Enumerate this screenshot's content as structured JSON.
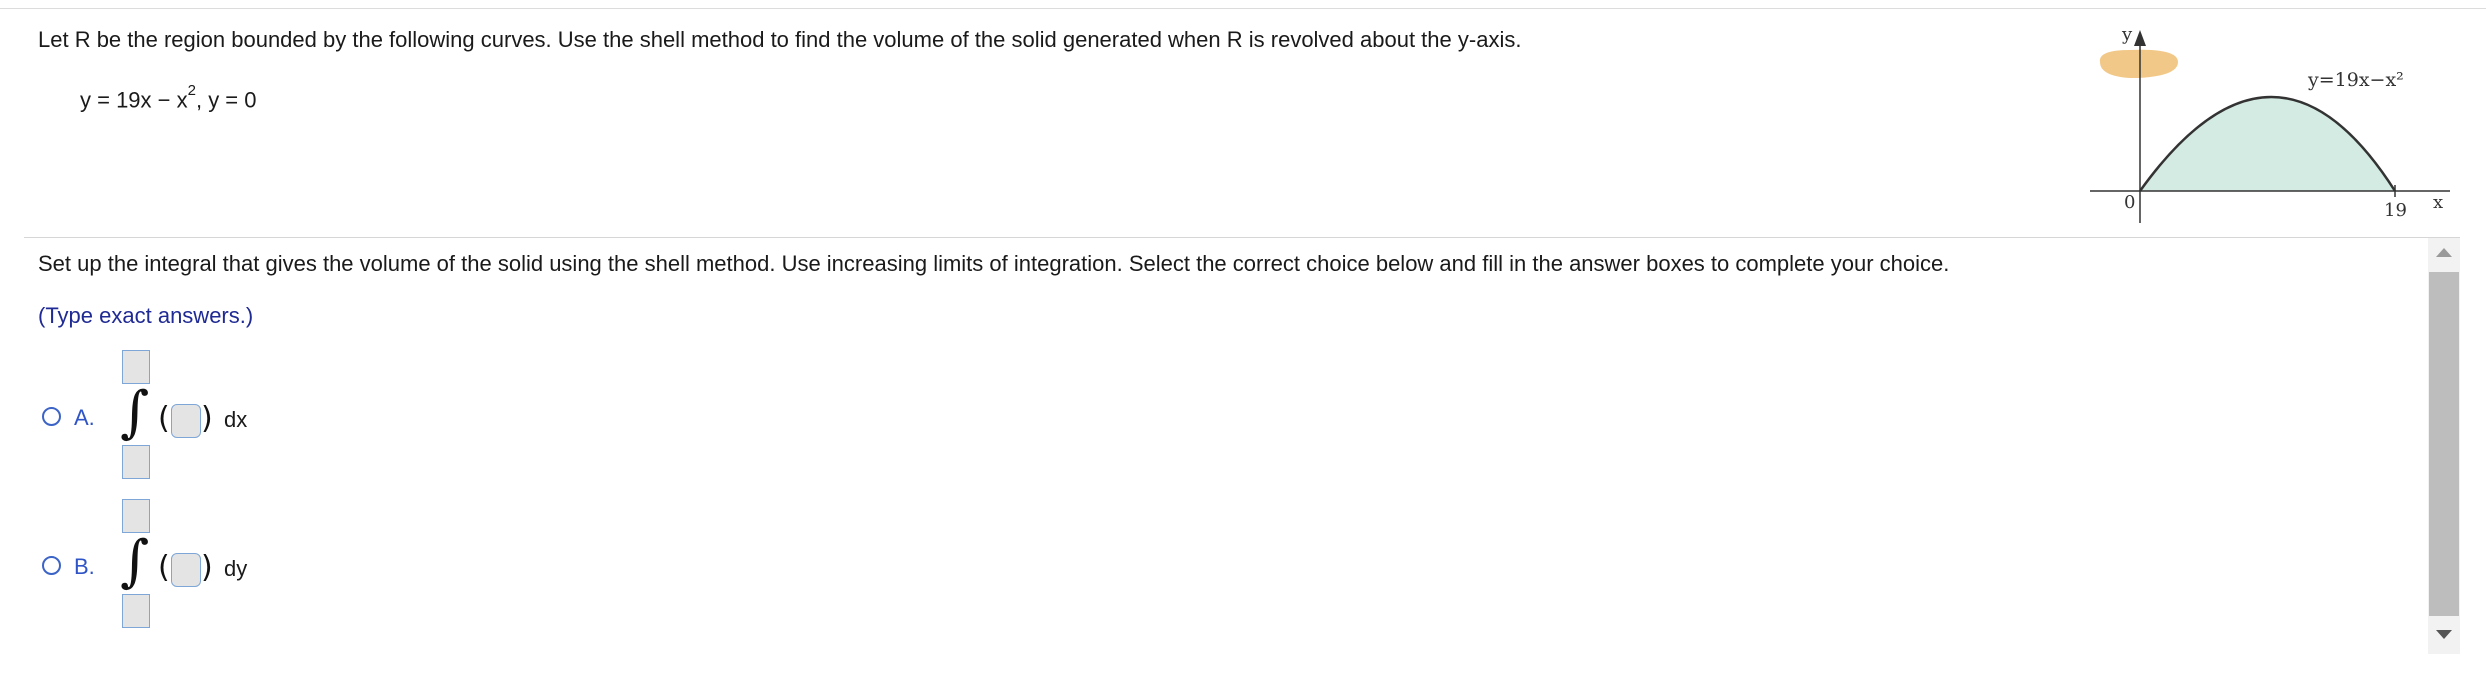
{
  "problem": {
    "statement": "Let R be the region bounded by the following curves. Use the shell method to find the volume of the solid generated when R is revolved about the y-axis.",
    "equation_main": "y = 19x − x",
    "equation_exponent": "2",
    "equation_rest": ", y = 0"
  },
  "graph": {
    "y_axis_label": "y",
    "x_axis_label": "x",
    "origin_label": "0",
    "x_tick_label": "19",
    "curve_label": "y=19x−x²",
    "region_color": "#d4ebe3",
    "revolve_arrow_color": "#f0c27a"
  },
  "instructions": "Set up the integral that gives the volume of the solid using the shell method. Use increasing limits of integration. Select the correct choice below and fill in the answer boxes to complete your choice.",
  "hint": "(Type exact answers.)",
  "choices": [
    {
      "letter": "A.",
      "open_paren": "(",
      "close_paren": ")",
      "integral_sign": "∫",
      "differential": "dx"
    },
    {
      "letter": "B.",
      "open_paren": "(",
      "close_paren": ")",
      "integral_sign": "∫",
      "differential": "dy"
    }
  ]
}
